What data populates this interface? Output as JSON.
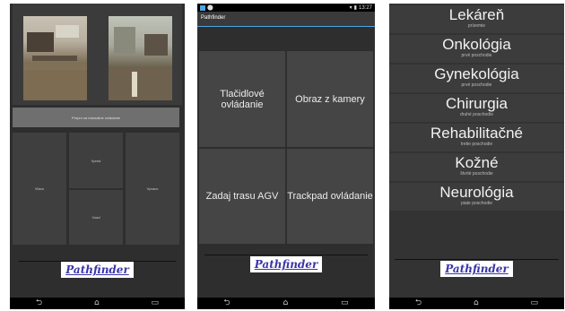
{
  "navbar": {
    "back": "⮌",
    "home": "⌂",
    "recent": "▭"
  },
  "phone1": {
    "wide_button": "Prepni na manuálne ovládanie",
    "controls": {
      "up": "Vpred",
      "down": "Vzad",
      "left": "Vľavo",
      "right": "Vpravo"
    },
    "logo": "Pathfinder"
  },
  "phone2": {
    "status_time": "13:27",
    "app_title": "Pathfinder",
    "buttons": [
      "Tlačidlové ovládanie",
      "Obraz z kamery",
      "Zadaj trasu AGV",
      "Trackpad ovládanie"
    ],
    "logo": "Pathfinder"
  },
  "phone3": {
    "departments": [
      {
        "name": "Lekáreň",
        "floor": "prízemie"
      },
      {
        "name": "Onkológia",
        "floor": "prvé poschodie"
      },
      {
        "name": "Gynekológia",
        "floor": "prvé poschodie"
      },
      {
        "name": "Chirurgia",
        "floor": "druhé poschodie"
      },
      {
        "name": "Rehabilitačné",
        "floor": "tretie poschodie"
      },
      {
        "name": "Kožné",
        "floor": "štvrté poschodie"
      },
      {
        "name": "Neurológia",
        "floor": "piate poschodie"
      }
    ],
    "logo": "Pathfinder"
  }
}
